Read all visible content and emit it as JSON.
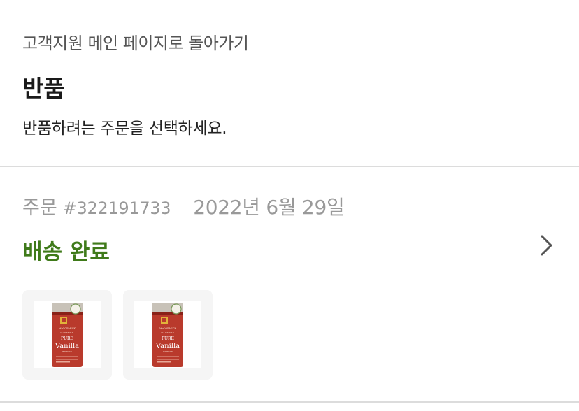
{
  "header": {
    "back_link": "고객지원 메인 페이지로 돌아가기",
    "title": "반품",
    "subtitle": "반품하려는 주문을 선택하세요."
  },
  "order": {
    "label": "주문",
    "number": "#322191733",
    "date": "2022년 6월 29일",
    "status": "배송 완료",
    "status_color": "#3f7a1a",
    "chevron_icon": "chevron-right-icon",
    "items": [
      {
        "image": "vanilla-extract-bottle",
        "brand_text": "McCORMICK",
        "line1": "ALL NATURAL",
        "line2": "PURE",
        "line3": "Vanilla",
        "line4": "EXTRACT"
      },
      {
        "image": "vanilla-extract-bottle",
        "brand_text": "McCORMICK",
        "line1": "ALL NATURAL",
        "line2": "PURE",
        "line3": "Vanilla",
        "line4": "EXTRACT"
      }
    ]
  }
}
